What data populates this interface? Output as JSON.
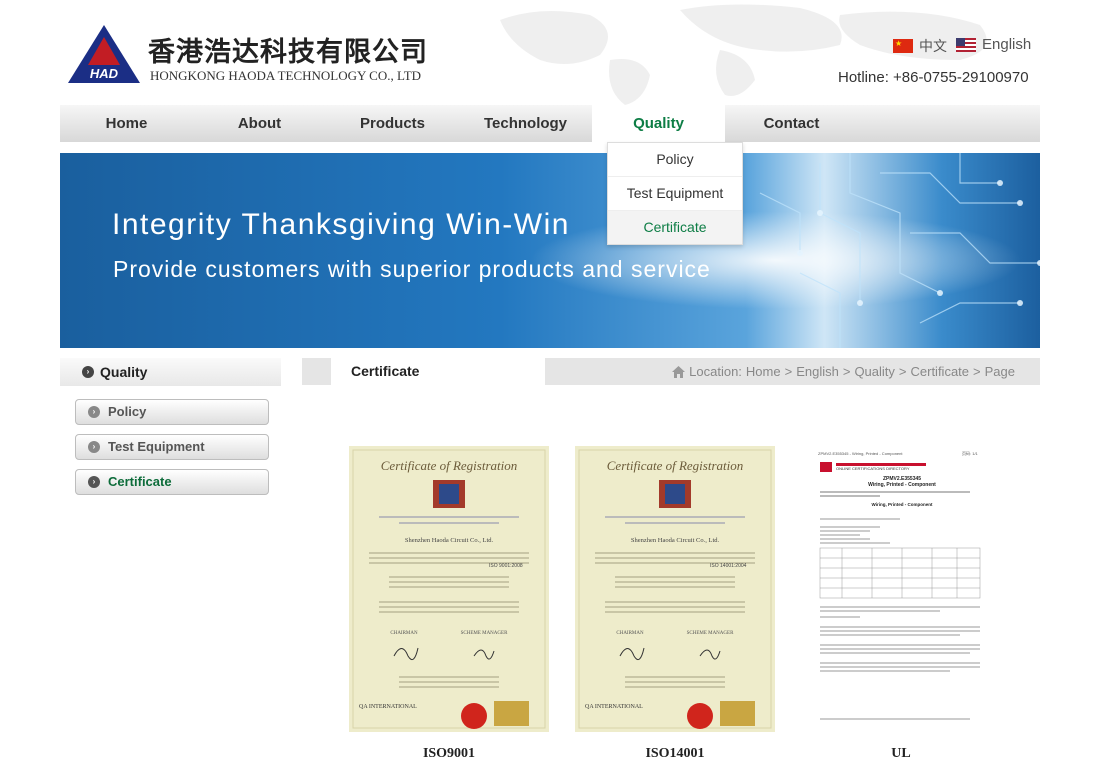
{
  "header": {
    "brand_cn": "香港浩达科技有限公司",
    "brand_en": "HONGKONG HAODA TECHNOLOGY CO., LTD",
    "logo_letters": "HAD",
    "lang_cn": "中文",
    "lang_en": "English",
    "hotline": "Hotline: +86-0755-29100970"
  },
  "nav": {
    "items": [
      "Home",
      "About",
      "Products",
      "Technology",
      "Quality",
      "Contact"
    ],
    "active": "Quality",
    "dropdown": [
      "Policy",
      "Test Equipment",
      "Certificate"
    ]
  },
  "banner": {
    "line1": "Integrity  Thanksgiving  Win-Win",
    "line2": "Provide customers with superior products and service"
  },
  "sidebar": {
    "title": "Quality",
    "items": [
      "Policy",
      "Test Equipment",
      "Certificate"
    ]
  },
  "content": {
    "title": "Certificate",
    "location_label": "Location:",
    "breadcrumb": [
      "Home",
      ">",
      "English",
      ">",
      "Quality",
      ">",
      "Certificate",
      ">",
      "Page"
    ]
  },
  "certificates": [
    {
      "label": "ISO9001",
      "heading": "Certificate of Registration",
      "company": "Shenzhen Haoda Circuit Co., Ltd.",
      "standard": "ISO 9001:2008",
      "org": "QA INTERNATIONAL",
      "roles": [
        "CHAIRMAN",
        "SCHEME MANAGER"
      ]
    },
    {
      "label": "ISO14001",
      "heading": "Certificate of Registration",
      "company": "Shenzhen Haoda Circuit Co., Ltd.",
      "standard": "ISO 14001:2004",
      "org": "QA INTERNATIONAL",
      "roles": [
        "CHAIRMAN",
        "SCHEME MANAGER"
      ]
    },
    {
      "label": "UL",
      "title": "ZPMV2.E355345",
      "subtitle": "Wiring, Printed - Component",
      "section": "Wiring, Printed - Component",
      "header_left": "ZPMV2.E355345 - Wiring, Printed - Component",
      "header_right": "页码: 1/1",
      "badge": "ONLINE CERTIFICATIONS DIRECTORY"
    }
  ],
  "colors": {
    "accent_green": "#0d7d45",
    "banner_blue": "#2378c0",
    "nav_grey": "#d8d8d8"
  }
}
